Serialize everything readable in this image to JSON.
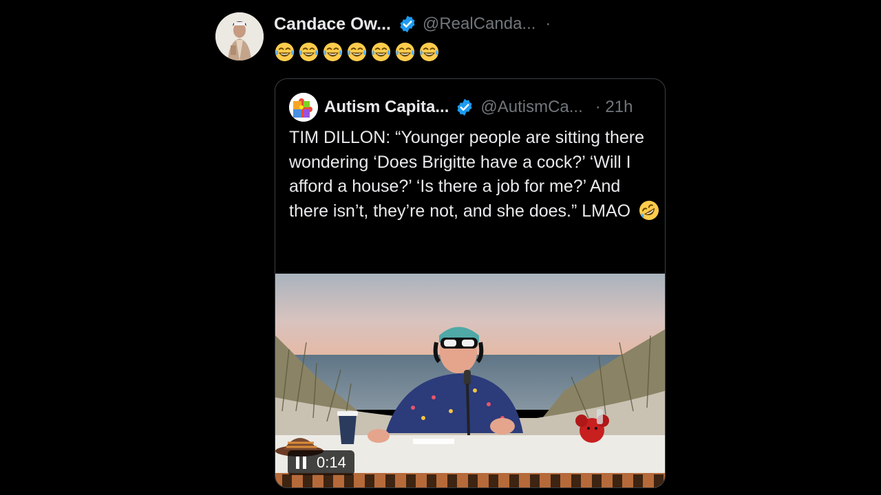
{
  "post": {
    "author_name": "Candace Ow...",
    "author_handle": "@RealCanda...",
    "separator": "·",
    "emoji_icon": "face-with-tears-of-joy-icon",
    "emoji_count": 7
  },
  "quote": {
    "author_name": "Autism Capita...",
    "author_handle": "@AutismCa...",
    "time": "· 21h",
    "text": "TIM DILLON: “Younger people are sitting there wondering ‘Does Brigitte have a cock?’ ‘Will I afford a house?’ ‘Is there a job for me?’ And there isn’t, they’re not, and she does.” LMAO",
    "text_emoji_icon": "rolling-on-floor-laughing-icon",
    "video": {
      "elapsed": "0:14",
      "state": "playing"
    }
  },
  "colors": {
    "background": "#000000",
    "text": "#e7e9ea",
    "secondary": "#71767b",
    "verified": "#1d9bf0",
    "border": "#3b4044"
  }
}
